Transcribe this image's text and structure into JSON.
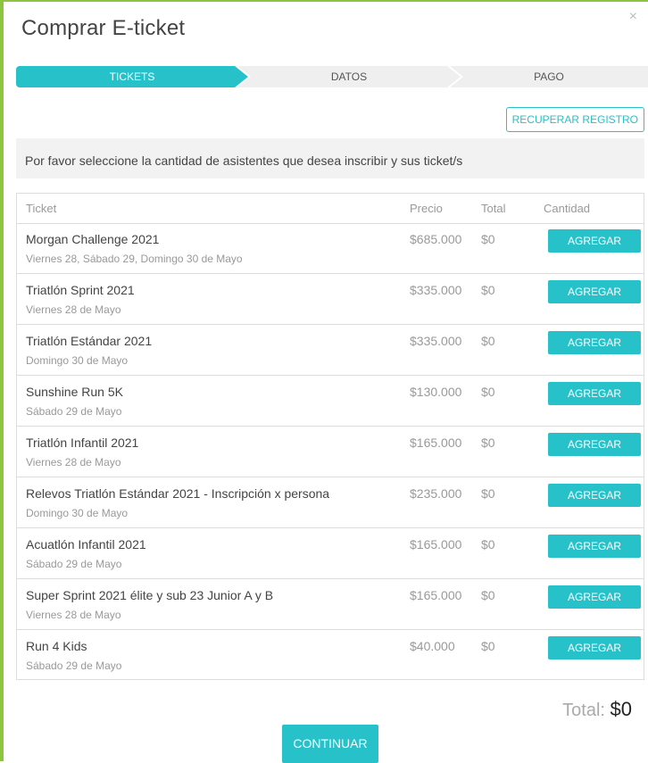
{
  "modal": {
    "title": "Comprar E-ticket",
    "close_symbol": "×"
  },
  "steps": [
    "TICKETS",
    "DATOS",
    "PAGO"
  ],
  "recover_button": "RECUPERAR REGISTRO",
  "info_text": "Por favor seleccione la cantidad de asistentes que desea inscribir y sus ticket/s",
  "table": {
    "headers": {
      "ticket": "Ticket",
      "price": "Precio",
      "total": "Total",
      "quantity": "Cantidad"
    },
    "rows": [
      {
        "name": "Morgan Challenge 2021",
        "date": "Viernes 28, Sábado 29, Domingo 30 de Mayo",
        "price": "$685.000",
        "total": "$0",
        "action": "AGREGAR"
      },
      {
        "name": "Triatlón Sprint 2021",
        "date": "Viernes 28 de Mayo",
        "price": "$335.000",
        "total": "$0",
        "action": "AGREGAR"
      },
      {
        "name": "Triatlón Estándar 2021",
        "date": "Domingo 30 de Mayo",
        "price": "$335.000",
        "total": "$0",
        "action": "AGREGAR"
      },
      {
        "name": "Sunshine Run 5K",
        "date": "Sábado 29 de Mayo",
        "price": "$130.000",
        "total": "$0",
        "action": "AGREGAR"
      },
      {
        "name": "Triatlón Infantil 2021",
        "date": "Viernes 28 de Mayo",
        "price": "$165.000",
        "total": "$0",
        "action": "AGREGAR"
      },
      {
        "name": "Relevos Triatlón Estándar 2021 - Inscripción x persona",
        "date": "Domingo 30 de Mayo",
        "price": "$235.000",
        "total": "$0",
        "action": "AGREGAR"
      },
      {
        "name": "Acuatlón Infantil 2021",
        "date": "Sábado 29 de Mayo",
        "price": "$165.000",
        "total": "$0",
        "action": "AGREGAR"
      },
      {
        "name": "Super Sprint 2021 élite y sub 23 Junior A y B",
        "date": "Viernes 28 de Mayo",
        "price": "$165.000",
        "total": "$0",
        "action": "AGREGAR"
      },
      {
        "name": "Run 4 Kids",
        "date": "Sábado 29 de Mayo",
        "price": "$40.000",
        "total": "$0",
        "action": "AGREGAR"
      }
    ]
  },
  "total": {
    "label": "Total:",
    "amount": "$0"
  },
  "continue_button": "CONTINUAR",
  "colors": {
    "accent": "#27c2c9",
    "frame": "#8cc63f"
  }
}
